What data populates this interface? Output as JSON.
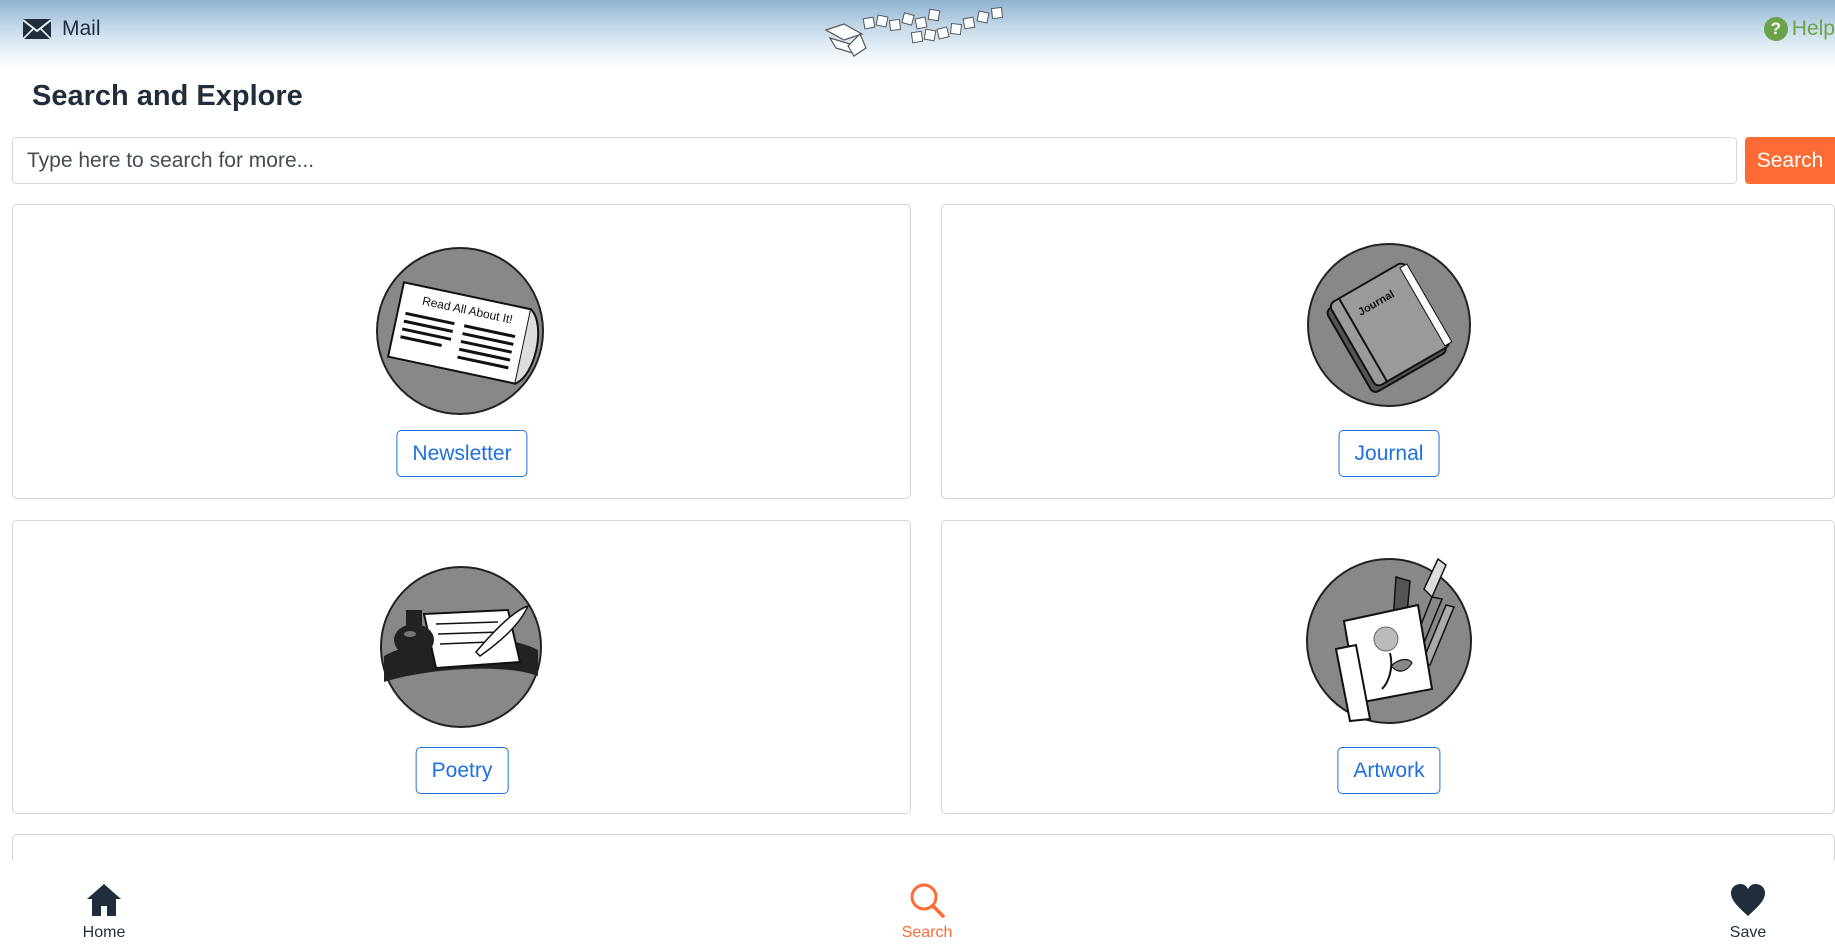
{
  "header": {
    "mail_label": "Mail",
    "mail_icon": "envelope-icon",
    "help_label": "Help",
    "help_icon": "question-circle-icon",
    "help_glyph": "?",
    "logo": "site-logo"
  },
  "page_title": "Search and Explore",
  "search": {
    "placeholder": "Type here to search for more...",
    "button_label": "Search"
  },
  "categories": [
    {
      "label": "Newsletter",
      "icon": "newspaper-icon"
    },
    {
      "label": "Journal",
      "icon": "journal-book-icon"
    },
    {
      "label": "Poetry",
      "icon": "quill-ink-icon"
    },
    {
      "label": "Artwork",
      "icon": "paintbrush-art-icon"
    }
  ],
  "bottom_nav": [
    {
      "label": "Home",
      "icon": "home-icon",
      "active": false
    },
    {
      "label": "Search",
      "icon": "search-icon",
      "active": true
    },
    {
      "label": "Save",
      "icon": "heart-icon",
      "active": false
    }
  ],
  "colors": {
    "accent": "#ff6b35",
    "link_blue": "#1f6fe0",
    "help_green": "#6aa34a",
    "text_dark": "#1f2d3d"
  }
}
